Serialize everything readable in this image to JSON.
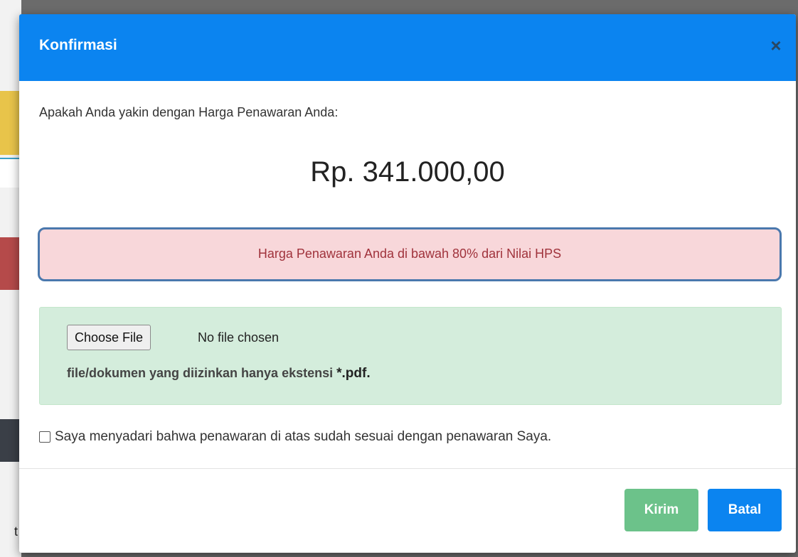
{
  "modal": {
    "title": "Konfirmasi",
    "close_glyph": "×",
    "prompt": "Apakah Anda yakin dengan Harga Penawaran Anda:",
    "amount": "Rp. 341.000,00",
    "warning": "Harga Penawaran Anda di bawah 80% dari Nilai HPS",
    "file": {
      "button_label": "Choose File",
      "status": "No file chosen",
      "note_prefix": "file/dokumen yang diizinkan hanya ekstensi ",
      "note_ext": "*.pdf."
    },
    "agreement": "Saya menyadari bahwa penawaran di atas sudah sesuai dengan penawaran Saya.",
    "buttons": {
      "submit": "Kirim",
      "cancel": "Batal"
    }
  },
  "background": {
    "partial_text": "t"
  },
  "colors": {
    "header": "#0b84f0",
    "danger_bg": "#f8d7da",
    "danger_text": "#a0333c",
    "highlight_border": "#4a78ad",
    "success_bg": "#d4eddc",
    "submit_button": "#6cc28a",
    "cancel_button": "#0b84f0"
  }
}
